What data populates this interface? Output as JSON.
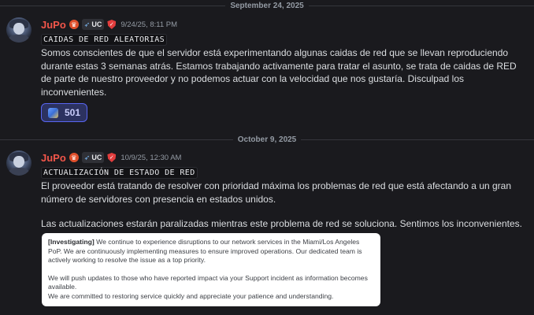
{
  "dividers": [
    {
      "date": "September 24, 2025"
    },
    {
      "date": "October 9, 2025"
    }
  ],
  "messages": [
    {
      "username": "JuPo",
      "tag": "UC",
      "timestamp": "9/24/25, 8:11 PM",
      "title": "CAIDAS DE RED ALEATORIAS",
      "paragraphs": [
        "Somos conscientes de que el servidor está experimentando algunas caidas de red que se llevan reproduciendo durante estas 3 semanas atrás. Estamos trabajando activamente para tratar el asunto, se trata de caidas de RED de parte de nuestro proveedor y no podemos actuar con la velocidad que nos gustaría. Disculpad los inconvenientes."
      ],
      "reaction": {
        "emoji": "server-emoji",
        "count": "501"
      }
    },
    {
      "username": "JuPo",
      "tag": "UC",
      "timestamp": "10/9/25, 12:30 AM",
      "title": "ACTUALIZACIÓN DE ESTADO DE RED",
      "paragraphs": [
        "El proveedor está tratando de resolver con prioridad máxima los problemas de red que está afectando a un gran número de servidores con presencia en estados unidos.",
        "Las actualizaciones estarán paralizadas mientras este problema de red se soluciona. Sentimos los inconvenientes."
      ],
      "embed": {
        "label": "[Investigating]",
        "line1": " We continue to experience disruptions to our network services in the Miami/Los Angeles PoP.  We are continuously implementing measures to ensure improved operations. Our dedicated team is actively working to resolve the issue as a top priority.",
        "line2": "We will push updates to those who have reported impact via your Support incident as information becomes available.",
        "line3": "We are committed to restoring service quickly and appreciate your patience and understanding."
      }
    }
  ],
  "colors": {
    "background": "#1a1a1e",
    "username": "#f2564a",
    "reaction_border": "#5865f2"
  },
  "icons": [
    "crown-badge-icon",
    "rocket-icon",
    "shield-icon"
  ]
}
